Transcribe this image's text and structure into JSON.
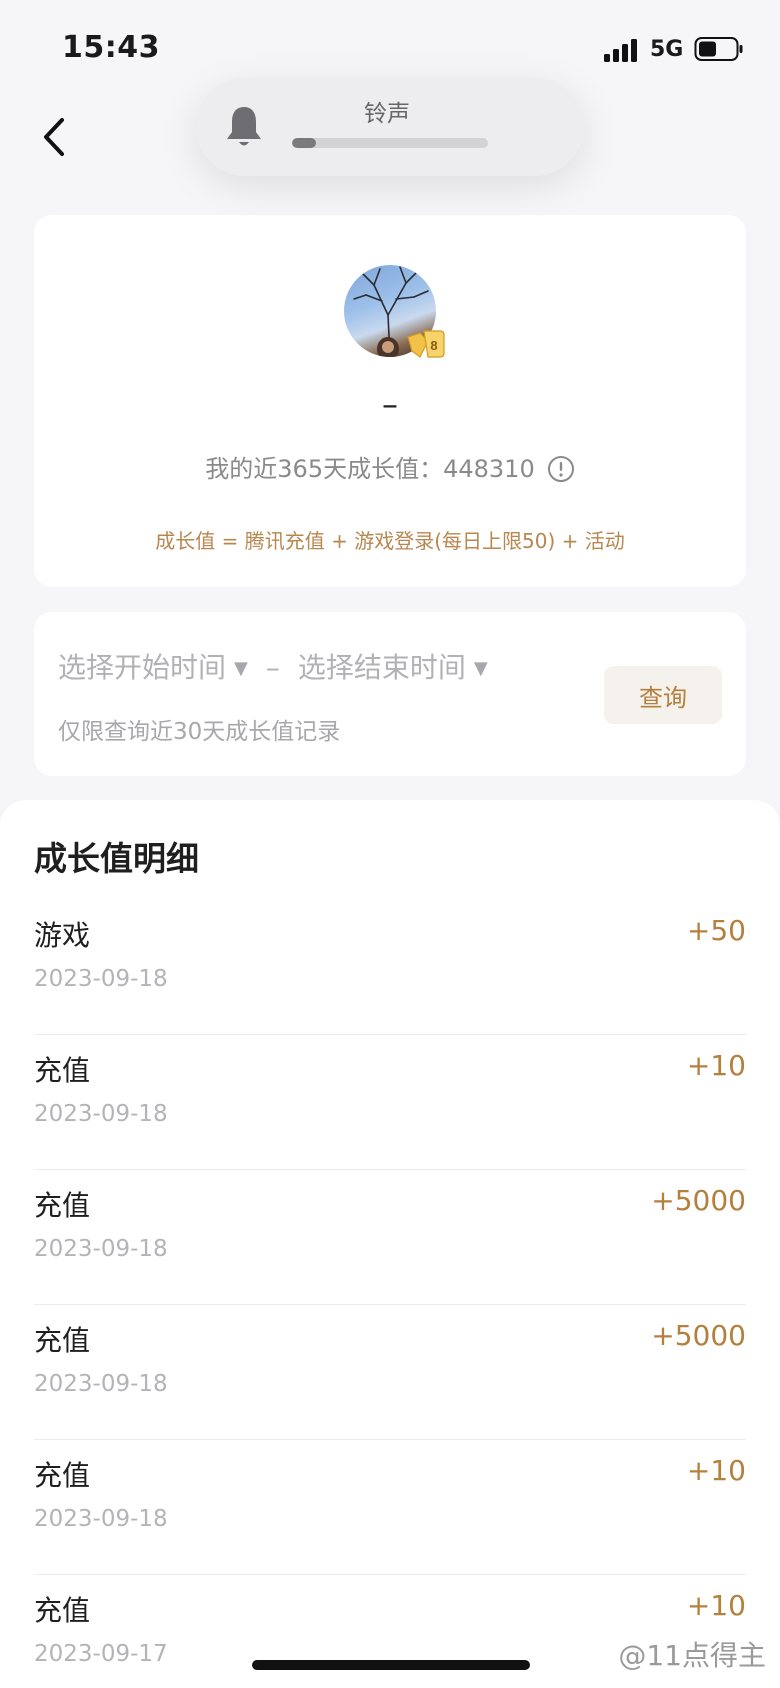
{
  "status_bar": {
    "time": "15:43",
    "network": "5G"
  },
  "ringer": {
    "label": "铃声",
    "level": 0.12
  },
  "profile": {
    "name": "–",
    "growth_label": "我的近365天成长值：",
    "growth_value": "448310",
    "formula": "成长值 = 腾讯充值 + 游戏登录(每日上限50) + 活动"
  },
  "query": {
    "start_placeholder": "选择开始时间",
    "end_placeholder": "选择结束时间",
    "separator": "–",
    "hint": "仅限查询近30天成长值记录",
    "button_label": "查询"
  },
  "details": {
    "title": "成长值明细",
    "items": [
      {
        "type": "游戏",
        "date": "2023-09-18",
        "amount": "+50"
      },
      {
        "type": "充值",
        "date": "2023-09-18",
        "amount": "+10"
      },
      {
        "type": "充值",
        "date": "2023-09-18",
        "amount": "+5000"
      },
      {
        "type": "充值",
        "date": "2023-09-18",
        "amount": "+5000"
      },
      {
        "type": "充值",
        "date": "2023-09-18",
        "amount": "+10"
      },
      {
        "type": "充值",
        "date": "2023-09-17",
        "amount": "+10"
      }
    ]
  },
  "watermark": "@11点得主",
  "colors": {
    "accent": "#b4803e",
    "background": "#f6f6f8"
  }
}
